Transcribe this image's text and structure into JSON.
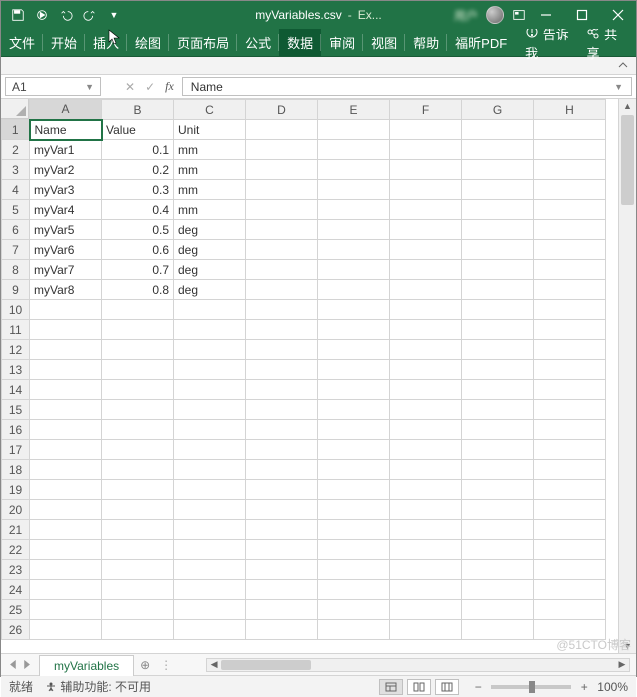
{
  "title": {
    "filename": "myVariables.csv",
    "appsuffix": "Ex...",
    "username": "用户"
  },
  "qat": {
    "autosave_off": "",
    "save": "",
    "undo": "",
    "redo": ""
  },
  "ribbon": {
    "tabs": [
      "文件",
      "开始",
      "插入",
      "绘图",
      "页面布局",
      "公式",
      "数据",
      "审阅",
      "视图",
      "帮助",
      "福昕PDF"
    ],
    "active": "数据",
    "tell_me": "告诉我",
    "share": "共享"
  },
  "namebox": "A1",
  "formula_value": "Name",
  "columns": [
    "A",
    "B",
    "C",
    "D",
    "E",
    "F",
    "G",
    "H"
  ],
  "rows_shown": 26,
  "selected_cell": {
    "row": 1,
    "col": 0
  },
  "data_cells": {
    "1": {
      "A": "Name",
      "B": "Value",
      "C": "Unit"
    },
    "2": {
      "A": "myVar1",
      "B": "0.1",
      "C": "mm"
    },
    "3": {
      "A": "myVar2",
      "B": "0.2",
      "C": "mm"
    },
    "4": {
      "A": "myVar3",
      "B": "0.3",
      "C": "mm"
    },
    "5": {
      "A": "myVar4",
      "B": "0.4",
      "C": "mm"
    },
    "6": {
      "A": "myVar5",
      "B": "0.5",
      "C": "deg"
    },
    "7": {
      "A": "myVar6",
      "B": "0.6",
      "C": "deg"
    },
    "8": {
      "A": "myVar7",
      "B": "0.7",
      "C": "deg"
    },
    "9": {
      "A": "myVar8",
      "B": "0.8",
      "C": "deg"
    }
  },
  "numeric_cols": [
    "B"
  ],
  "sheet_tab": "myVariables",
  "status": {
    "ready": "就绪",
    "a11y_prefix": "辅助功能:",
    "a11y_value": "不可用",
    "zoom": "100%"
  },
  "watermark": "@51CTO博客"
}
